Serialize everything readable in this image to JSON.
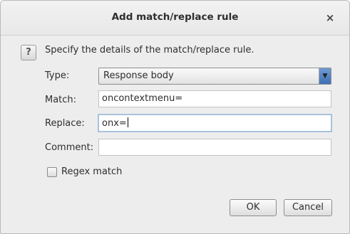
{
  "dialog": {
    "title": "Add match/replace rule",
    "close_glyph": "×"
  },
  "intro": {
    "icon_glyph": "?",
    "text": "Specify the details of the match/replace rule."
  },
  "form": {
    "type_label": "Type:",
    "type_value": "Response body",
    "dropdown_glyph": "▼",
    "match_label": "Match:",
    "match_value": "oncontextmenu=",
    "replace_label": "Replace:",
    "replace_value": "onx=",
    "comment_label": "Comment:",
    "comment_value": "",
    "regex_label": "Regex match",
    "regex_checked": false
  },
  "buttons": {
    "ok": "OK",
    "cancel": "Cancel"
  }
}
